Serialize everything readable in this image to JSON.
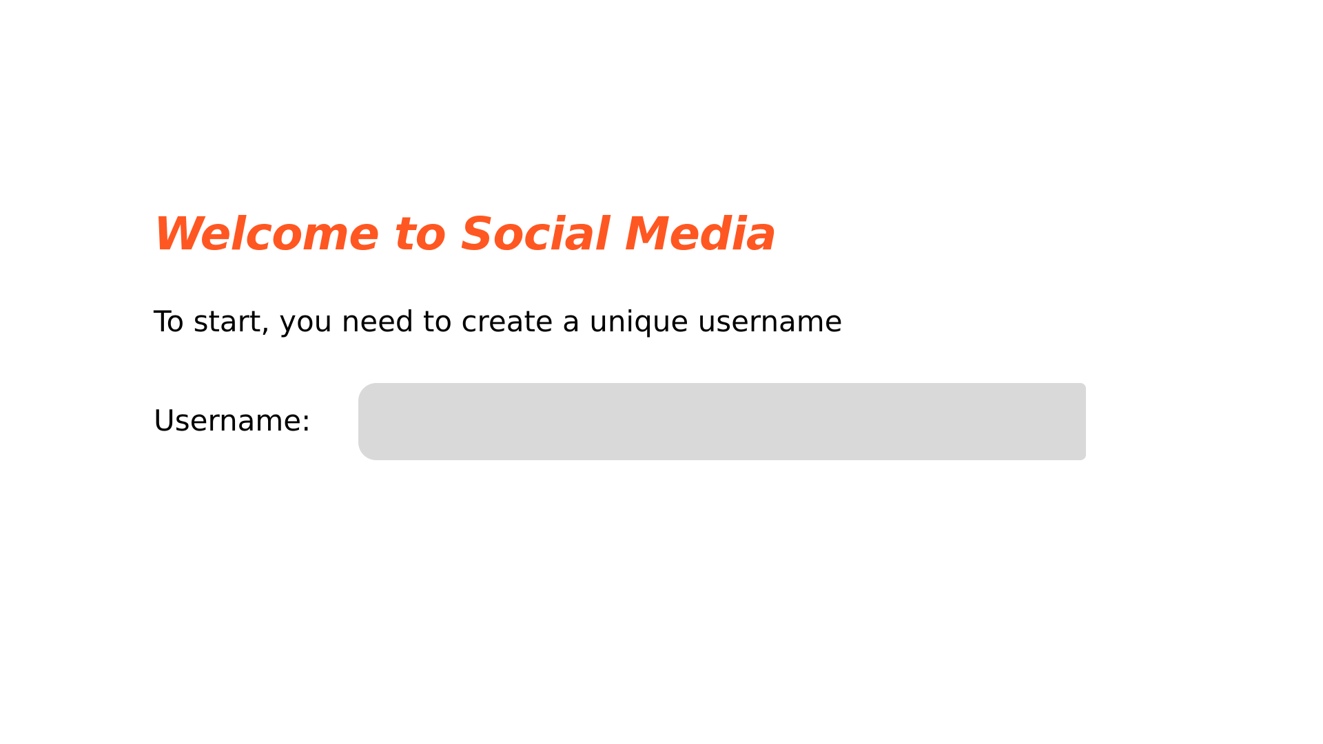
{
  "header": {
    "title": "Welcome to Social Media",
    "subtitle": "To start, you need to create a unique username"
  },
  "form": {
    "username_label": "Username:",
    "username_value": "",
    "username_placeholder": ""
  },
  "colors": {
    "accent": "#ff5722",
    "input_background": "#d9d9d9",
    "text": "#000000",
    "background": "#ffffff"
  }
}
